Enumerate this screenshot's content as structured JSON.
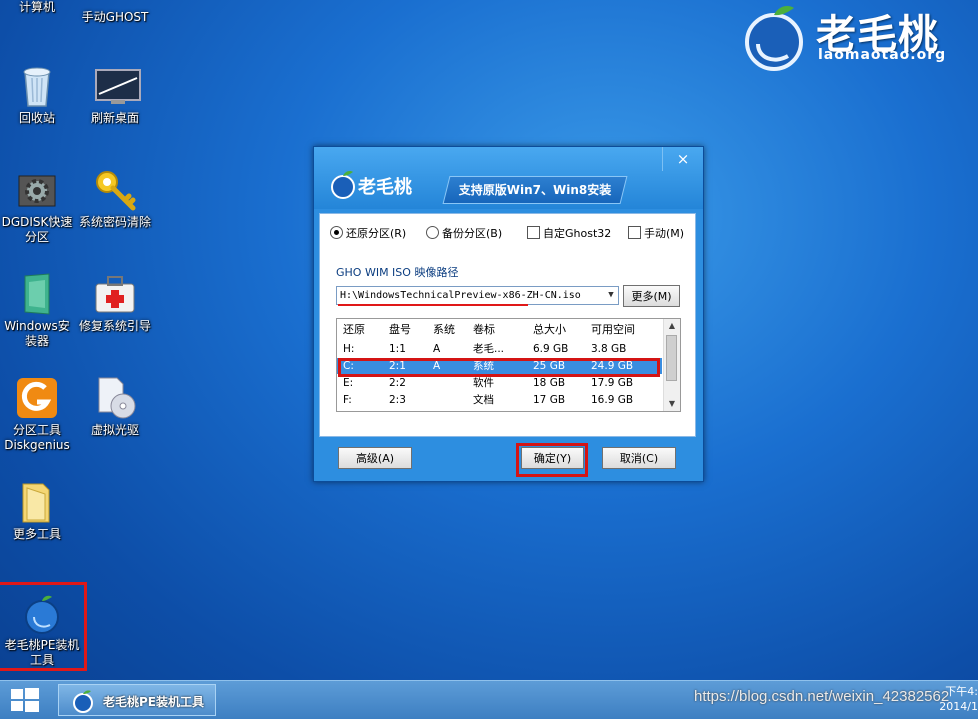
{
  "desktop": {
    "icons": [
      {
        "label": "计算机"
      },
      {
        "label": "手动GHOST"
      },
      {
        "label": "回收站"
      },
      {
        "label": "刷新桌面"
      },
      {
        "label": "DGDISK快速分区"
      },
      {
        "label": "系统密码清除"
      },
      {
        "label": "Windows安装器"
      },
      {
        "label": "修复系统引导"
      },
      {
        "label": "分区工具Diskgenius"
      },
      {
        "label": "虚拟光驱"
      },
      {
        "label": "更多工具"
      },
      {
        "label": "老毛桃PE装机工具"
      }
    ]
  },
  "brand": {
    "name": "老毛桃",
    "url": "laomaotao.org"
  },
  "dialog": {
    "close": "×",
    "logo_text": "老毛桃",
    "banner": "支持原版Win7、Win8安装",
    "options": {
      "restore": "还原分区(R)",
      "backup": "备份分区(B)",
      "custom_ghost": "自定Ghost32",
      "manual": "手动(M)"
    },
    "path_label": "GHO WIM ISO 映像路径",
    "path_value": "H:\\WindowsTechnicalPreview-x86-ZH-CN.iso",
    "more_button": "更多(M)",
    "table": {
      "headers": [
        "还原",
        "盘号",
        "系统",
        "卷标",
        "总大小",
        "可用空间"
      ],
      "rows": [
        [
          "H:",
          "1:1",
          "A",
          "老毛...",
          "6.9 GB",
          "3.8 GB"
        ],
        [
          "C:",
          "2:1",
          "A",
          "系统",
          "25 GB",
          "24.9 GB"
        ],
        [
          "E:",
          "2:2",
          "",
          "软件",
          "18 GB",
          "17.9 GB"
        ],
        [
          "F:",
          "2:3",
          "",
          "文档",
          "17 GB",
          "16.9 GB"
        ]
      ]
    },
    "advanced_button": "高级(A)",
    "ok_button": "确定(Y)",
    "cancel_button": "取消(C)"
  },
  "taskbar": {
    "task_label": "老毛桃PE装机工具",
    "watermark": "https://blog.csdn.net/weixin_42382562",
    "clock_time": "下午4:",
    "clock_date": "2014/1"
  },
  "colors": {
    "accent": "#1a6fd0",
    "highlight": "#3a8de0",
    "annotation_red": "#d41414"
  }
}
